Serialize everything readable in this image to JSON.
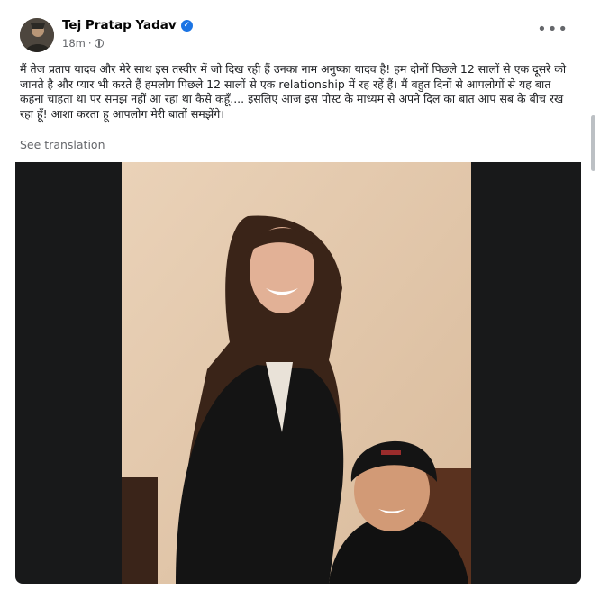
{
  "post": {
    "author": "Tej Pratap Yadav",
    "time": "18m",
    "visibility_separator": "·",
    "more_label": "•••",
    "text": "मैं तेज प्रताप यादव और  मेरे साथ इस तस्वीर में जो दिख रही हैं उनका नाम अनुष्का यादव है! हम दोनों पिछले 12 सालों से एक दूसरे को जानते है और प्यार भी करते हैं हमलोग पिछले 12 सालों से एक relationship में रह रहें हैं। मैं बहुत दिनों से आपलोगों से यह बात कहना चाहता था पर समझ नहीं आ रहा था कैसे कहूँ.... इसलिए आज इस पोस्ट के माध्यम से अपने दिल का बात आप सब के बीच रख रहा हूँ! आशा करता हू आपलोग मेरी बातों समझेंगे।",
    "see_translation": "See translation",
    "verified_glyph": "✓"
  },
  "icons": {
    "avatar": "profile-avatar",
    "verified": "verified-badge-icon",
    "globe": "globe-icon",
    "more": "more-options-icon"
  },
  "colors": {
    "accent": "#1b74e4",
    "secondary_text": "#65676b",
    "photo_background": "#18191a"
  }
}
